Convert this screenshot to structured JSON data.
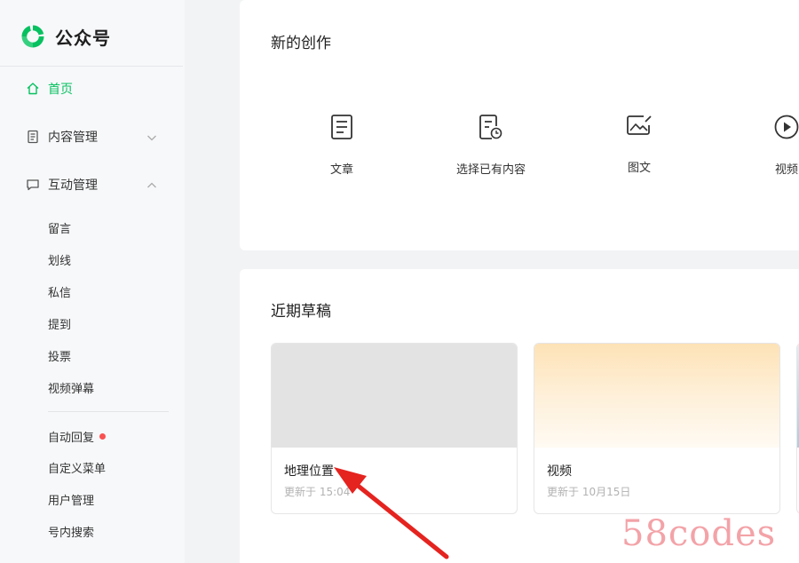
{
  "brand": {
    "name": "公众号",
    "color": "#07c160"
  },
  "nav": {
    "home": "首页",
    "content": "内容管理",
    "interaction": "互动管理",
    "sub_items": [
      "留言",
      "划线",
      "私信",
      "提到",
      "投票",
      "视频弹幕"
    ],
    "sub_items_2": [
      "自动回复",
      "自定义菜单",
      "用户管理",
      "号内搜索"
    ]
  },
  "create": {
    "title": "新的创作",
    "items": [
      {
        "label": "文章",
        "icon": "document-icon"
      },
      {
        "label": "选择已有内容",
        "icon": "document-clock-icon"
      },
      {
        "label": "图文",
        "icon": "image-edit-icon"
      },
      {
        "label": "视频",
        "icon": "play-icon"
      }
    ]
  },
  "drafts": {
    "title": "近期草稿",
    "items": [
      {
        "title": "地理位置",
        "time": "更新于 15:04"
      },
      {
        "title": "视频",
        "time": "更新于 10月15日"
      }
    ]
  },
  "watermark": "58codes",
  "colors": {
    "accent": "#07c160",
    "badge": "#fa5151",
    "arrow": "#e5231f"
  }
}
